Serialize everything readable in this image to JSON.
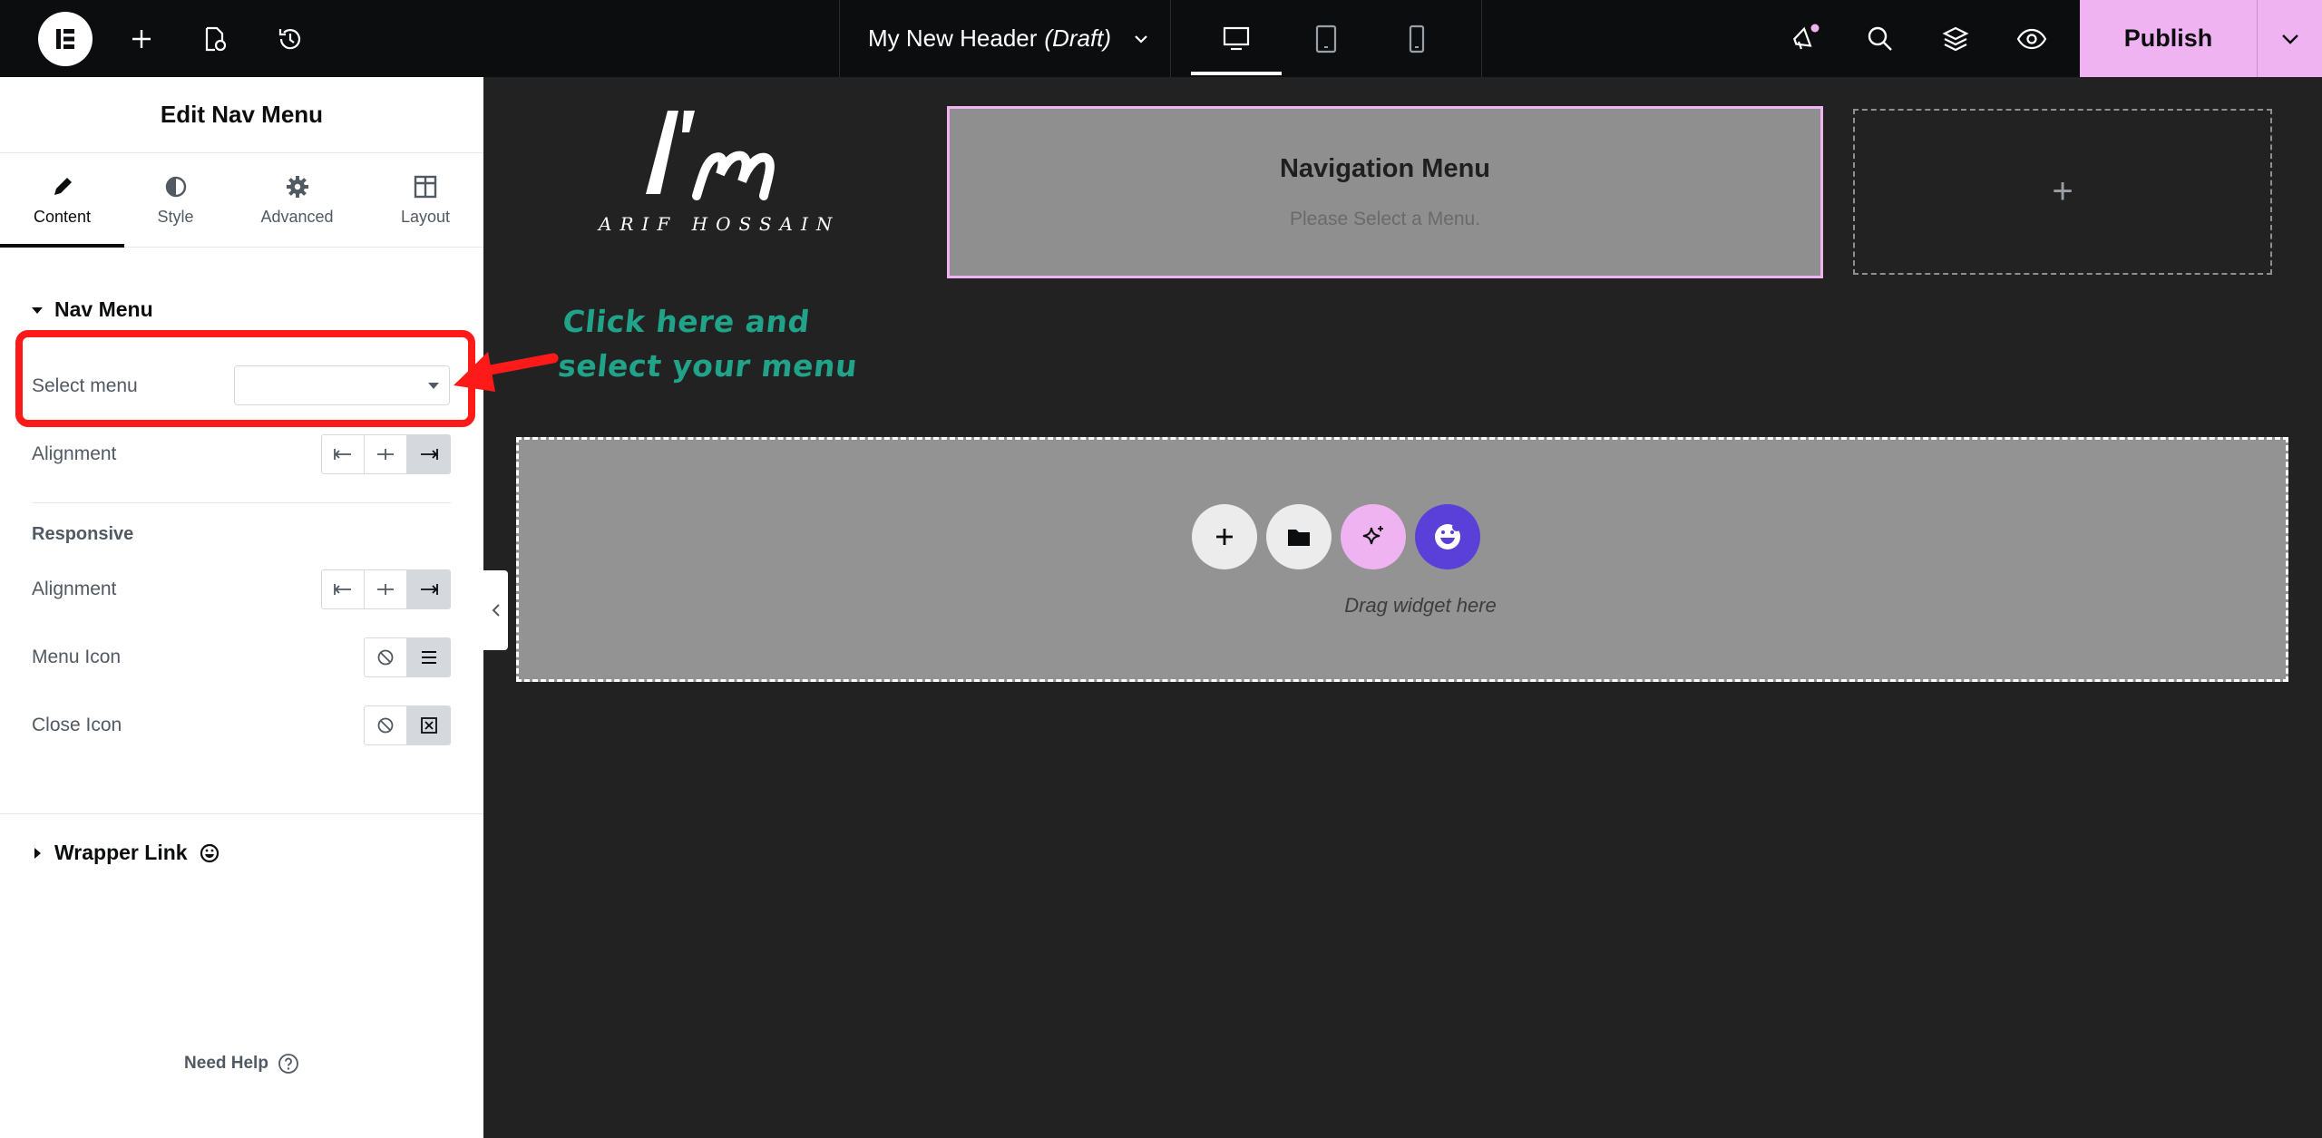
{
  "topbar": {
    "document_title": "My New Header",
    "document_status": "(Draft)",
    "publish_label": "Publish"
  },
  "panel": {
    "title": "Edit Nav Menu",
    "tabs": [
      {
        "label": "Content",
        "icon": "pencil-icon",
        "active": true
      },
      {
        "label": "Style",
        "icon": "contrast-icon",
        "active": false
      },
      {
        "label": "Advanced",
        "icon": "gear-icon",
        "active": false
      },
      {
        "label": "Layout",
        "icon": "layout-icon",
        "active": false
      }
    ],
    "nav_menu_section": "Nav Menu",
    "select_menu_label": "Select menu",
    "select_menu_value": "",
    "alignment_label": "Alignment",
    "responsive_heading": "Responsive",
    "responsive_alignment_label": "Alignment",
    "menu_icon_label": "Menu Icon",
    "close_icon_label": "Close Icon",
    "wrapper_link_section": "Wrapper Link",
    "need_help": "Need Help"
  },
  "canvas": {
    "logo_text_top": "I'm",
    "logo_text_bottom": "ARIF HOSSAIN",
    "nav_widget_title": "Navigation Menu",
    "nav_widget_subtitle": "Please Select a Menu.",
    "empty_column_symbol": "+",
    "drop_area_text": "Drag widget here"
  },
  "annotation": {
    "callout_line1": "Click here and",
    "callout_line2": "select your menu",
    "color": "#21a389",
    "highlight_color": "#ff1a1a"
  },
  "colors": {
    "accent": "#f0b3f2",
    "topbar": "#0c0d0e",
    "canvas": "#222222",
    "ai_button": "#f0b3f2",
    "emoji_button": "#5b3fd9"
  }
}
